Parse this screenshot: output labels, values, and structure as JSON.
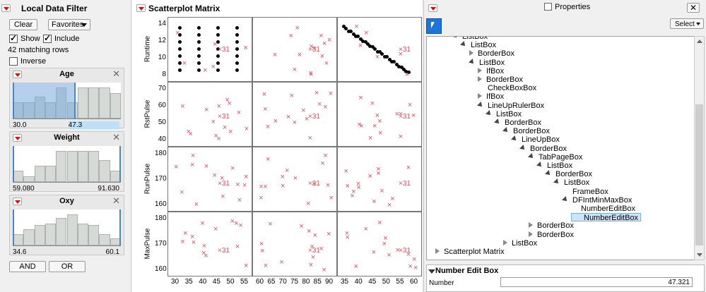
{
  "filter": {
    "title": "Local Data Filter",
    "clear_label": "Clear",
    "favorites_label": "Favorites",
    "show_label": "Show",
    "include_label": "Include",
    "matching": "42 matching rows",
    "inverse_label": "Inverse",
    "cards": [
      {
        "title": "Age",
        "lo": "30.0",
        "hi": "47.3",
        "bars": [
          0.45,
          0.45,
          0.6,
          0.45,
          0.85,
          0.45,
          0.85,
          0.85,
          0.85,
          0.7
        ],
        "selected": [
          0.0,
          0.58
        ]
      },
      {
        "title": "Weight",
        "lo": "59.080",
        "hi": "91.630",
        "bars": [
          0.3,
          0.15,
          0.45,
          0.45,
          0.85,
          0.85,
          0.85,
          0.85,
          0.6,
          0.3
        ],
        "selected": null
      },
      {
        "title": "Oxy",
        "lo": "34.6",
        "hi": "60.1",
        "bars": [
          0.3,
          0.45,
          0.55,
          0.6,
          0.75,
          0.85,
          0.6,
          0.55,
          0.3,
          0.2
        ],
        "selected": null
      }
    ],
    "and_label": "AND",
    "or_label": "OR"
  },
  "matrix": {
    "title": "Scatterplot Matrix",
    "rows": [
      "Runtime",
      "RstPulse",
      "RunPulse",
      "MaxPulse"
    ],
    "label31": "31",
    "yticks": [
      [
        "14",
        "12",
        "10",
        "8"
      ],
      [
        "70",
        "60",
        "50",
        "40"
      ],
      [
        "180",
        "170",
        "160"
      ],
      [
        "180",
        "170",
        "160"
      ]
    ],
    "xticks": [
      [
        "30",
        "35",
        "40",
        "45",
        "50",
        "55"
      ],
      [
        "60",
        "65",
        "70",
        "75",
        "80",
        "85",
        "90"
      ],
      [
        "35",
        "40",
        "45",
        "50",
        "55",
        "60"
      ]
    ],
    "colors": {
      "marker": "#e0505a",
      "dot": "#000000"
    }
  },
  "properties": {
    "title": "Properties",
    "select_label": "Select",
    "tree": [
      {
        "label": "ListBox",
        "depth": 4,
        "icon": "dn"
      },
      {
        "label": "ListBox",
        "depth": 5,
        "icon": "dn"
      },
      {
        "label": "BorderBox",
        "depth": 6,
        "icon": "rt"
      },
      {
        "label": "ListBox",
        "depth": 6,
        "icon": "dn"
      },
      {
        "label": "IfBox",
        "depth": 7,
        "icon": "rt"
      },
      {
        "label": "BorderBox",
        "depth": 7,
        "icon": "rt"
      },
      {
        "label": "CheckBoxBox",
        "depth": 7,
        "icon": "none"
      },
      {
        "label": "IfBox",
        "depth": 7,
        "icon": "rt"
      },
      {
        "label": "LineUpRulerBox",
        "depth": 7,
        "icon": "dn"
      },
      {
        "label": "ListBox",
        "depth": 8,
        "icon": "dn"
      },
      {
        "label": "BorderBox",
        "depth": 9,
        "icon": "dn"
      },
      {
        "label": "BorderBox",
        "depth": 10,
        "icon": "dn"
      },
      {
        "label": "LineUpBox",
        "depth": 11,
        "icon": "dn"
      },
      {
        "label": "BorderBox",
        "depth": 12,
        "icon": "dn"
      },
      {
        "label": "TabPageBox",
        "depth": 13,
        "icon": "dn"
      },
      {
        "label": "ListBox",
        "depth": 14,
        "icon": "dn"
      },
      {
        "label": "BorderBox",
        "depth": 15,
        "icon": "dn"
      },
      {
        "label": "ListBox",
        "depth": 16,
        "icon": "dn"
      },
      {
        "label": "FrameBox",
        "depth": 17,
        "icon": "none"
      },
      {
        "label": "DFIntMinMaxBox",
        "depth": 17,
        "icon": "dn"
      },
      {
        "label": "NumberEditBox",
        "depth": 18,
        "icon": "none"
      },
      {
        "label": "NumberEditBox",
        "depth": 18,
        "icon": "none",
        "selected": true
      },
      {
        "label": "BorderBox",
        "depth": 13,
        "icon": "rt"
      },
      {
        "label": "BorderBox",
        "depth": 13,
        "icon": "rt"
      },
      {
        "label": "ListBox",
        "depth": 10,
        "icon": "rt"
      },
      {
        "label": "Scatterplot Matrix",
        "depth": 2,
        "icon": "rt"
      }
    ],
    "section_title": "Number Edit Box",
    "number_label": "Number",
    "number_value": "47.321"
  }
}
